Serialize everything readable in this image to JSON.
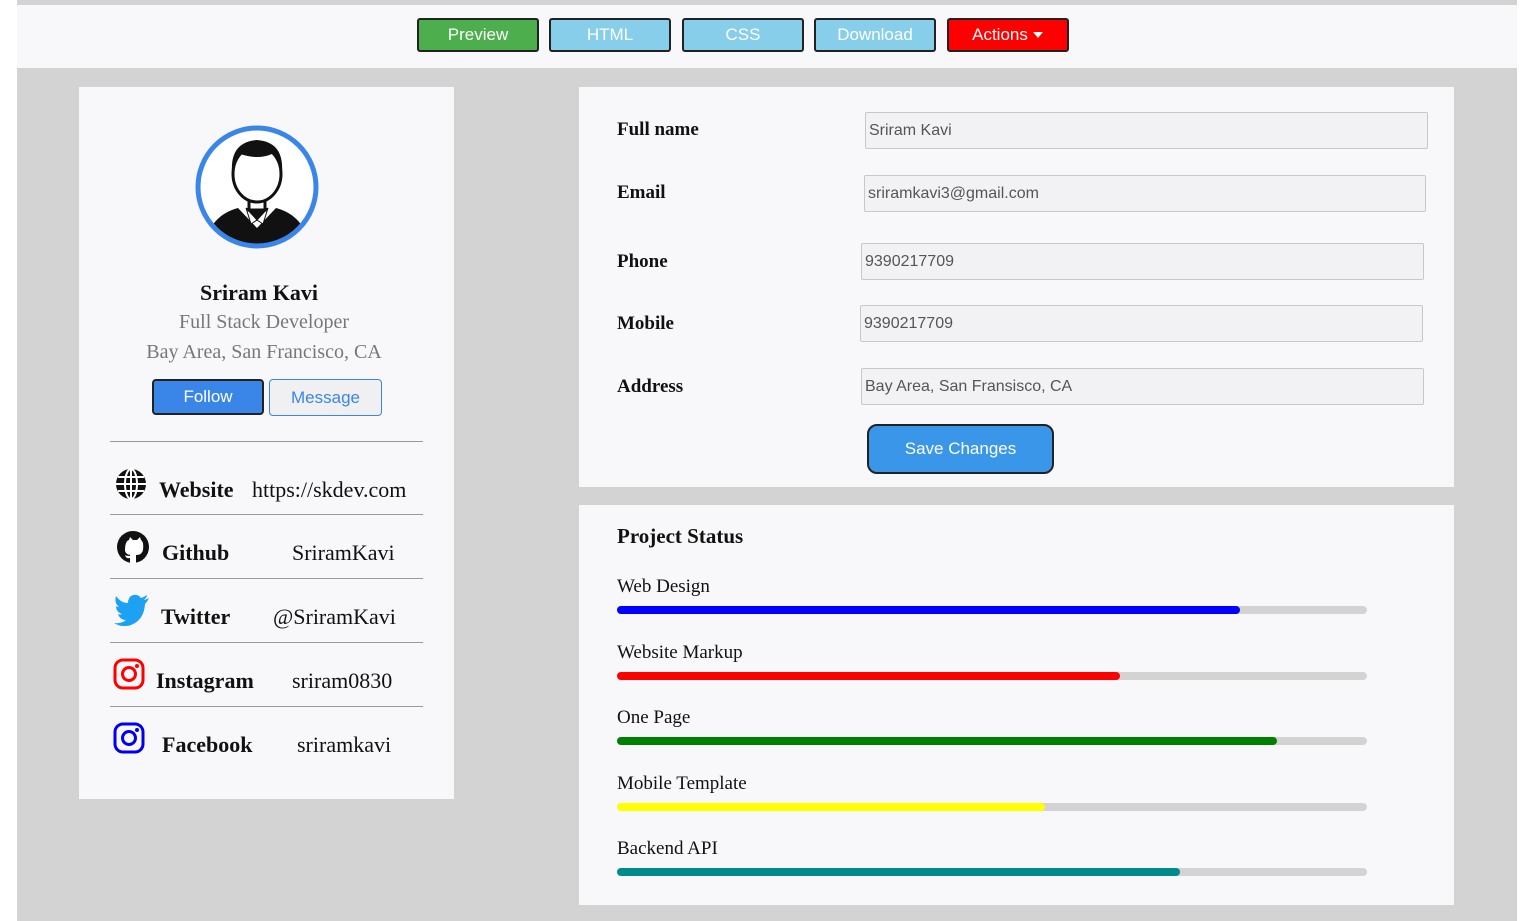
{
  "toolbar": {
    "buttons": [
      {
        "label": "Preview",
        "color": "#4cae4c"
      },
      {
        "label": "HTML",
        "color": "#87ceeb"
      },
      {
        "label": "CSS",
        "color": "#87ceeb"
      },
      {
        "label": "Download",
        "color": "#87ceeb"
      },
      {
        "label": "Actions",
        "color": "#ff0000",
        "icon": "caret-down-icon"
      }
    ]
  },
  "profile": {
    "name": "Sriram Kavi",
    "role": "Full Stack Developer",
    "location": "Bay Area, San Francisco, CA",
    "follow_label": "Follow",
    "message_label": "Message",
    "accent_color": "#3a86e8"
  },
  "social": [
    {
      "icon": "globe-icon",
      "label": "Website",
      "value": "https://skdev.com"
    },
    {
      "icon": "github-icon",
      "label": "Github",
      "value": "SriramKavi"
    },
    {
      "icon": "twitter-icon",
      "label": "Twitter",
      "value": "@SriramKavi"
    },
    {
      "icon": "instagram-icon",
      "label": "Instagram",
      "value": "sriram0830"
    },
    {
      "icon": "instagram-icon",
      "label": "Facebook",
      "value": "sriramkavi"
    }
  ],
  "form": {
    "fields": [
      {
        "label": "Full name",
        "value": "Sriram Kavi"
      },
      {
        "label": "Email",
        "value": "sriramkavi3@gmail.com"
      },
      {
        "label": "Phone",
        "value": "9390217709"
      },
      {
        "label": "Mobile",
        "value": "9390217709"
      },
      {
        "label": "Address",
        "value": "Bay Area, San Fransisco, CA"
      }
    ],
    "save_label": "Save Changes"
  },
  "projects": {
    "title": "Project Status",
    "items": [
      {
        "label": "Web Design",
        "percent": 83,
        "color": "#0000ff"
      },
      {
        "label": "Website Markup",
        "percent": 67,
        "color": "#ff0000"
      },
      {
        "label": "One Page",
        "percent": 88,
        "color": "#008000"
      },
      {
        "label": "Mobile Template",
        "percent": 57,
        "color": "#ffff00"
      },
      {
        "label": "Backend API",
        "percent": 75,
        "color": "#008b8b"
      }
    ]
  }
}
